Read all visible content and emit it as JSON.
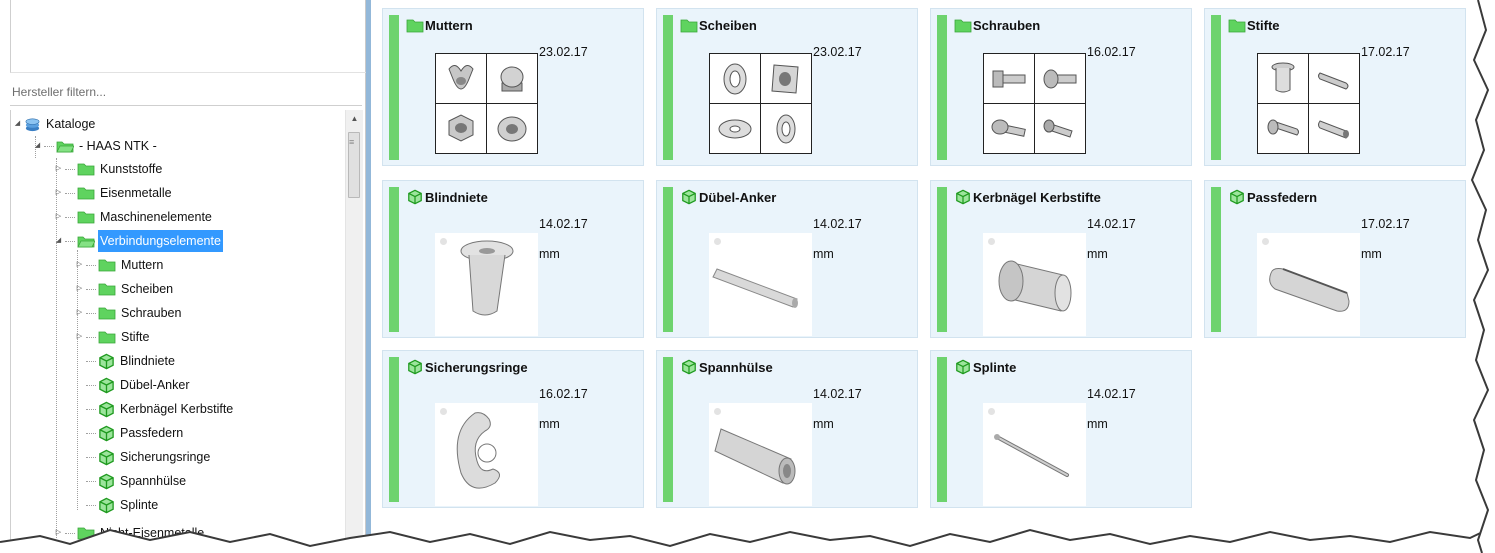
{
  "filter": {
    "placeholder": "Hersteller filtern..."
  },
  "tree": {
    "root": "Kataloge",
    "catalog": "- HAAS NTK -",
    "groups": [
      "Kunststoffe",
      "Eisenmetalle",
      "Maschinenelemente",
      "Verbindungselemente"
    ],
    "selected": "Verbindungselemente",
    "folders": [
      "Muttern",
      "Scheiben",
      "Schrauben",
      "Stifte"
    ],
    "parts": [
      "Blindniete",
      "Dübel-Anker",
      "Kerbnägel Kerbstifte",
      "Passfedern",
      "Sicherungsringe",
      "Spannhülse",
      "Splinte"
    ],
    "after": "Nicht-Eisenmetalle"
  },
  "cards": [
    {
      "title": "Muttern",
      "date": "23.02.17",
      "kind": "folder"
    },
    {
      "title": "Scheiben",
      "date": "23.02.17",
      "kind": "folder"
    },
    {
      "title": "Schrauben",
      "date": "16.02.17",
      "kind": "folder"
    },
    {
      "title": "Stifte",
      "date": "17.02.17",
      "kind": "folder"
    },
    {
      "title": "Blindniete",
      "date": "14.02.17",
      "unit": "mm",
      "kind": "part"
    },
    {
      "title": "Dübel-Anker",
      "date": "14.02.17",
      "unit": "mm",
      "kind": "part"
    },
    {
      "title": "Kerbnägel Kerbstifte",
      "date": "14.02.17",
      "unit": "mm",
      "kind": "part"
    },
    {
      "title": "Passfedern",
      "date": "17.02.17",
      "unit": "mm",
      "kind": "part"
    },
    {
      "title": "Sicherungsringe",
      "date": "16.02.17",
      "unit": "mm",
      "kind": "part"
    },
    {
      "title": "Spannhülse",
      "date": "14.02.17",
      "unit": "mm",
      "kind": "part"
    },
    {
      "title": "Splinte",
      "date": "14.02.17",
      "unit": "mm",
      "kind": "part"
    }
  ],
  "colors": {
    "accent_bar": "#6ed36e",
    "card_bg": "#eaf4fb",
    "selection": "#3399ff",
    "splitter": "#93b8d9",
    "folder": "#5fd35f"
  },
  "icons": {
    "folder": "folder-icon",
    "part": "part-cube-icon",
    "root": "catalog-stack-icon"
  }
}
